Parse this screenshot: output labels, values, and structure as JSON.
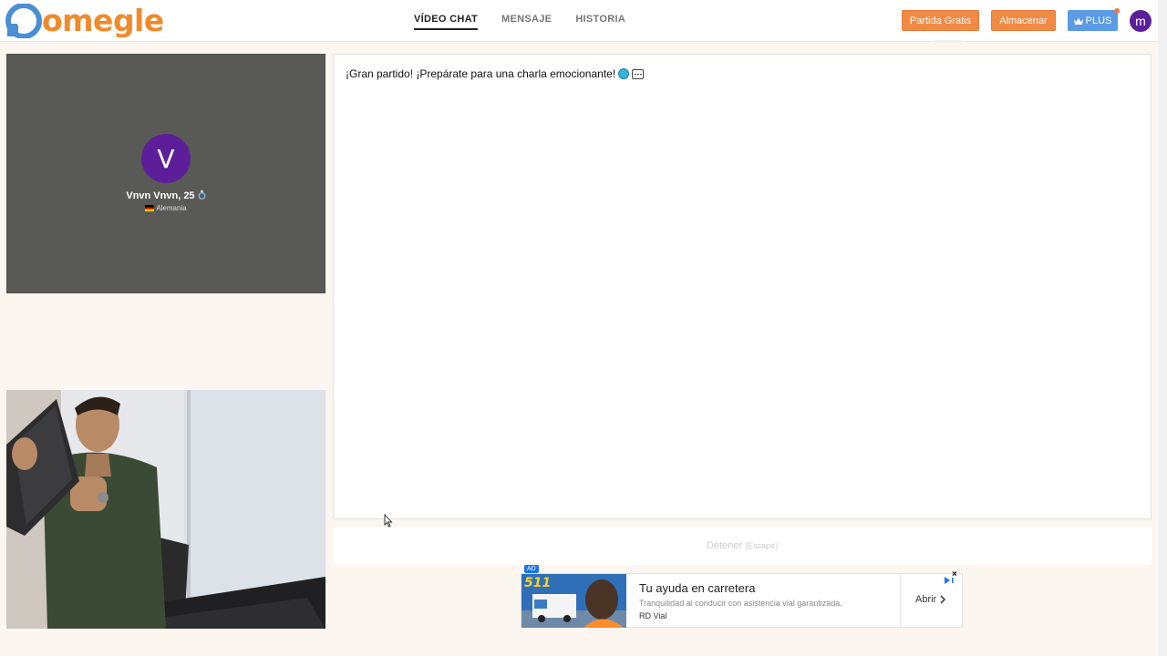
{
  "header": {
    "logo_text": "omegle",
    "nav": [
      {
        "label": "VÍDEO CHAT",
        "active": true
      },
      {
        "label": "MENSAJE",
        "active": false
      },
      {
        "label": "HISTORIA",
        "active": false
      }
    ],
    "free_match_label": "Partida Gratis",
    "store_label": "Almacenar",
    "plus_label": "PLUS",
    "user_initial": "m"
  },
  "remote": {
    "avatar_initial": "V",
    "name": "Vnvn Vnvn, 25",
    "country": "Alemania"
  },
  "chat": {
    "message": "¡Gran partido! ¡Prepárate para una charla emocionante!",
    "stop_label": "Detener",
    "stop_hint": "(Escape)"
  },
  "ad": {
    "badge": "AD",
    "title": "Tu ayuda en carretera",
    "description": "Tranquilidad al conducir con asistencia vial garantizada.",
    "brand": "RD Vial",
    "cta": "Abrir",
    "banner_number": "511",
    "close": "×"
  },
  "colors": {
    "brand_orange": "#f28a45",
    "plus_blue": "#5b9be6",
    "avatar_purple": "#5c1f99",
    "remote_bg": "#595a56",
    "page_bg": "#fbf6ef"
  }
}
